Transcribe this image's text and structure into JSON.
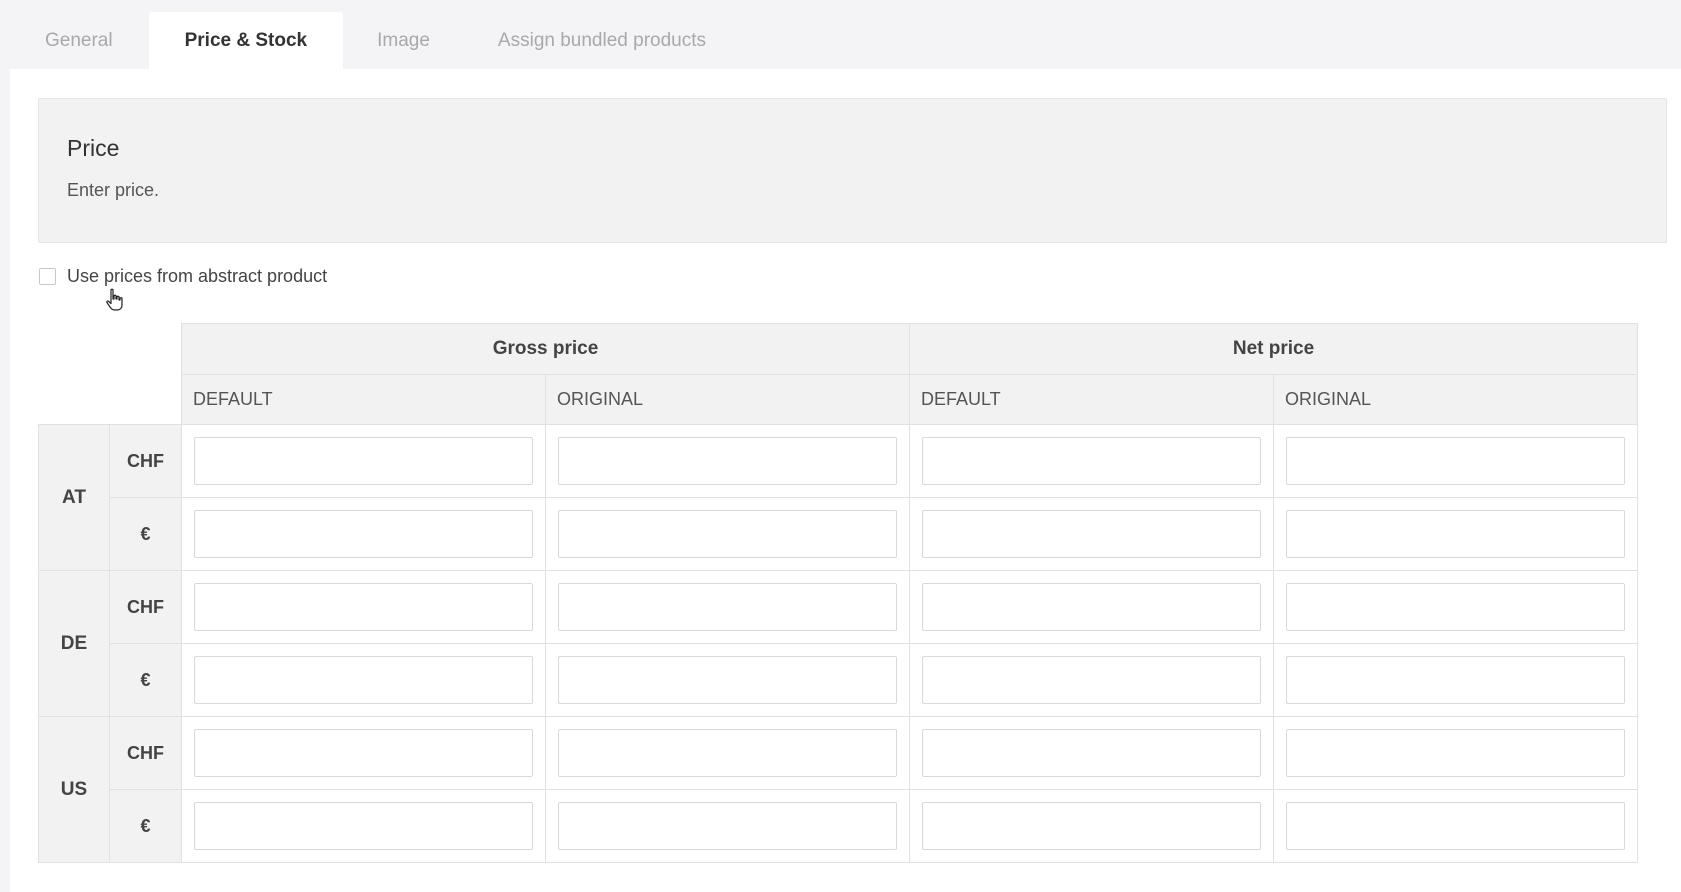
{
  "tabs": [
    {
      "label": "General",
      "active": false
    },
    {
      "label": "Price & Stock",
      "active": true
    },
    {
      "label": "Image",
      "active": false
    },
    {
      "label": "Assign bundled products",
      "active": false
    }
  ],
  "info": {
    "title": "Price",
    "description": "Enter price."
  },
  "checkbox": {
    "label": "Use prices from abstract product",
    "checked": false
  },
  "table": {
    "groups": [
      "Gross price",
      "Net price"
    ],
    "subheaders": [
      "DEFAULT",
      "ORIGINAL",
      "DEFAULT",
      "ORIGINAL"
    ],
    "rows": [
      {
        "country": "AT",
        "currencies": [
          "CHF",
          "€"
        ]
      },
      {
        "country": "DE",
        "currencies": [
          "CHF",
          "€"
        ]
      },
      {
        "country": "US",
        "currencies": [
          "CHF",
          "€"
        ]
      }
    ]
  },
  "icons": {
    "cursor": "hand-pointer-icon"
  }
}
